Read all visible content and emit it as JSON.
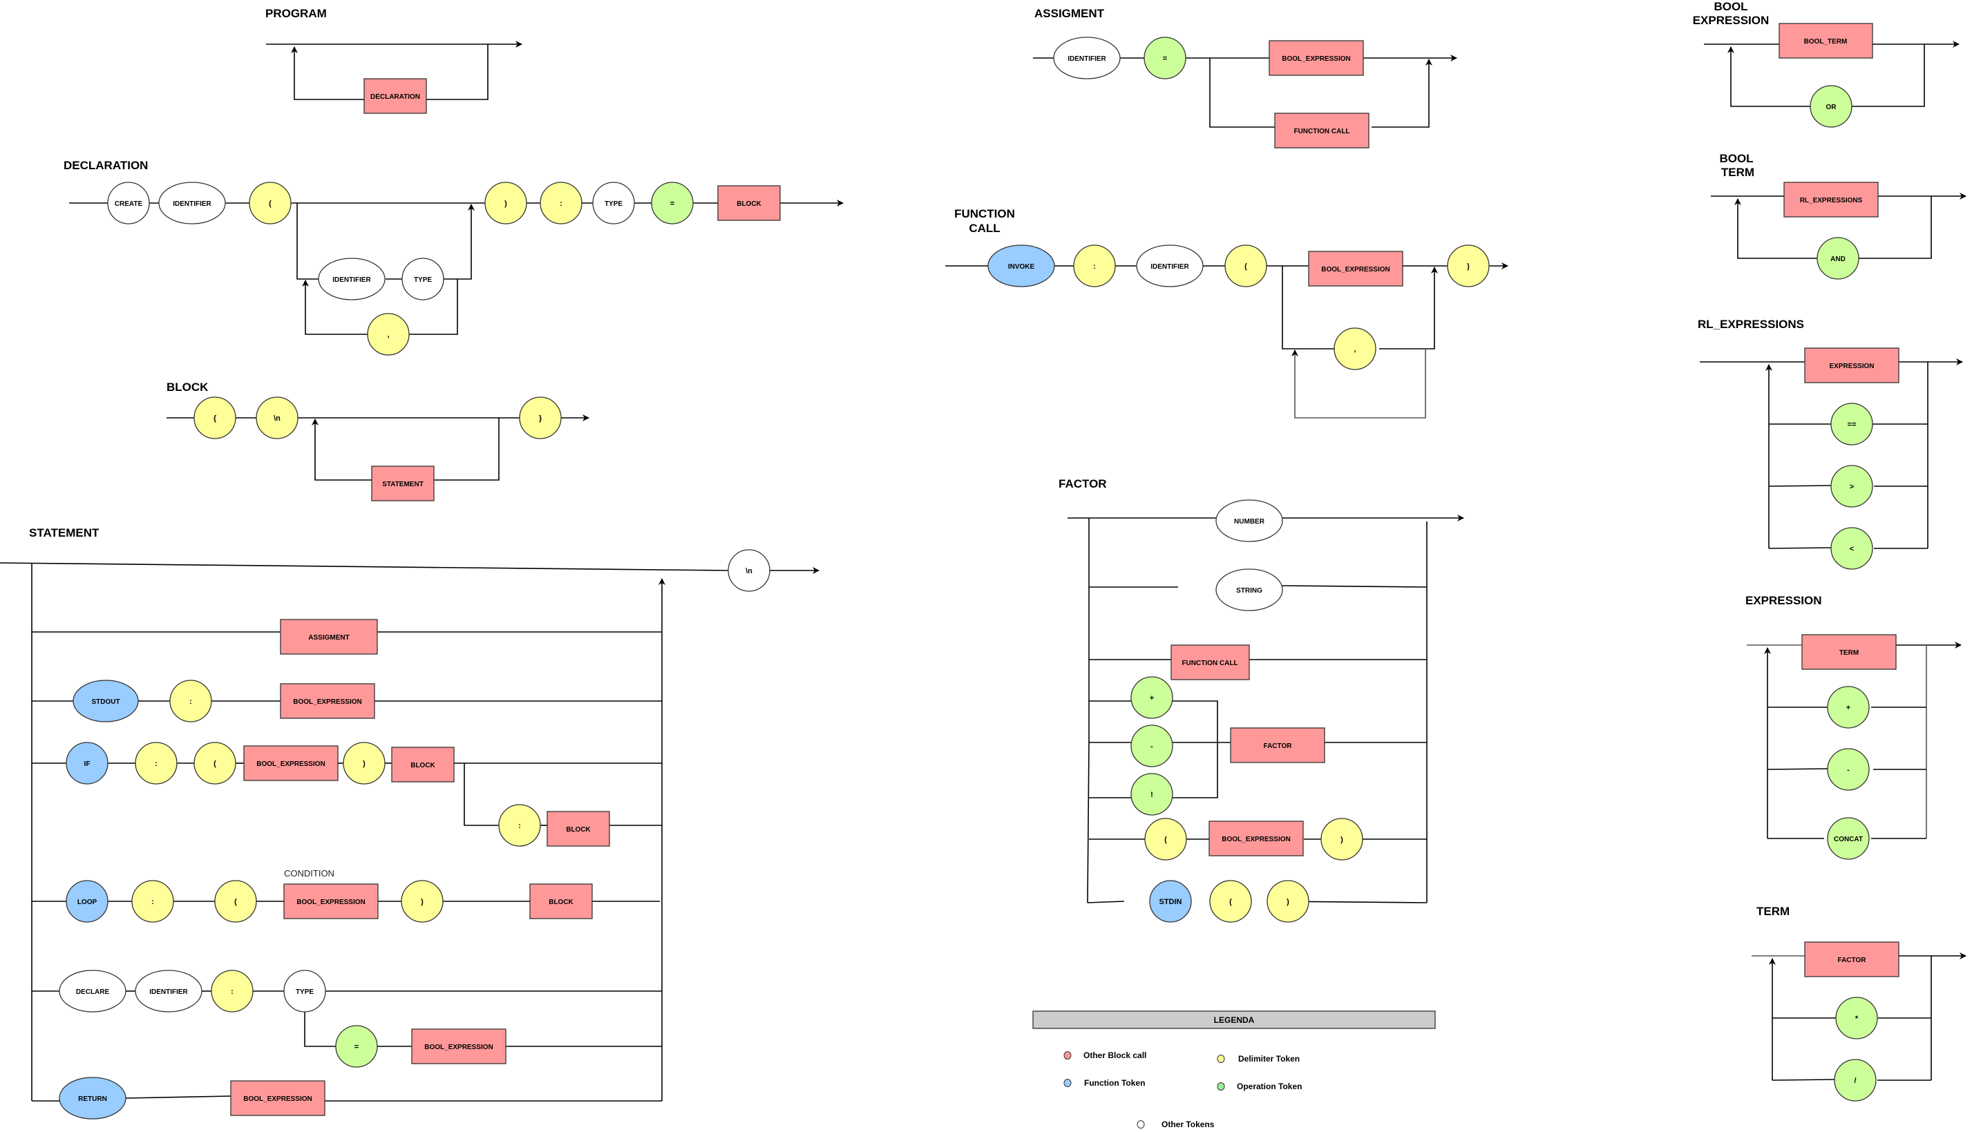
{
  "colors": {
    "block_call": "#ff9999",
    "function_token": "#99ccff",
    "delimiter_token": "#ffff99",
    "operation_token": "#ccff99",
    "other_token": "#ffffff",
    "legend_header": "#cccccc"
  },
  "titles": {
    "program": "PROGRAM",
    "declaration": "DECLARATION",
    "block": "BLOCK",
    "statement": "STATEMENT",
    "assigment": "ASSIGMENT",
    "function_call_1": "FUNCTION",
    "function_call_2": "CALL",
    "factor": "FACTOR",
    "bool_expression_1": "BOOL",
    "bool_expression_2": "EXPRESSION",
    "bool_term_1": "BOOL",
    "bool_term_2": "TERM",
    "rl_expressions": "RL_EXPRESSIONS",
    "expression": "EXPRESSION",
    "term": "TERM"
  },
  "program": {
    "declaration": "DECLARATION"
  },
  "declaration": {
    "create": "CREATE",
    "identifier": "IDENTIFIER",
    "lparen": "(",
    "rparen": ")",
    "colon": ":",
    "type": "TYPE",
    "assign": "=",
    "block": "BLOCK",
    "param_identifier": "IDENTIFIER",
    "param_type": "TYPE",
    "comma": ","
  },
  "block": {
    "lbrace": "{",
    "newline": "\\n",
    "statement": "STATEMENT",
    "rbrace": "}"
  },
  "statement": {
    "newline": "\\n",
    "assigment": "ASSIGMENT",
    "stdout": "STDOUT",
    "stdout_colon": ":",
    "stdout_expr": "BOOL_EXPRESSION",
    "if": "IF",
    "if_colon": ":",
    "if_lparen": "(",
    "if_expr": "BOOL_EXPRESSION",
    "if_rparen": ")",
    "if_block": "BLOCK",
    "else_colon": ":",
    "else_block": "BLOCK",
    "condition_note": "CONDITION",
    "loop": "LOOP",
    "loop_colon": ":",
    "loop_lparen": "(",
    "loop_expr": "BOOL_EXPRESSION",
    "loop_rparen": ")",
    "loop_block": "BLOCK",
    "declare": "DECLARE",
    "declare_identifier": "IDENTIFIER",
    "declare_colon": ":",
    "declare_type": "TYPE",
    "declare_assign": "=",
    "declare_expr": "BOOL_EXPRESSION",
    "return": "RETURN",
    "return_expr": "BOOL_EXPRESSION"
  },
  "assigment": {
    "identifier": "IDENTIFIER",
    "assign": "=",
    "bool_expression": "BOOL_EXPRESSION",
    "function_call": "FUNCTION CALL"
  },
  "function_call": {
    "invoke": "INVOKE",
    "colon": ":",
    "identifier": "IDENTIFIER",
    "lparen": "(",
    "bool_expression": "BOOL_EXPRESSION",
    "comma": ",",
    "rparen": ")"
  },
  "factor": {
    "number": "NUMBER",
    "string": "STRING",
    "function_call": "FUNCTION CALL",
    "plus": "+",
    "minus": "-",
    "not": "!",
    "factor": "FACTOR",
    "lparen": "(",
    "bool_expression": "BOOL_EXPRESSION",
    "rparen": ")",
    "stdin": "STDIN",
    "stdin_lparen": "(",
    "stdin_rparen": ")"
  },
  "bool_expression": {
    "bool_term": "BOOL_TERM",
    "or": "OR"
  },
  "bool_term": {
    "rl_expressions": "RL_EXPRESSIONS",
    "and": "AND"
  },
  "rl_expressions": {
    "expression": "EXPRESSION",
    "eq": "==",
    "gt": ">",
    "lt": "<"
  },
  "expression": {
    "term": "TERM",
    "plus": "+",
    "minus": "-",
    "concat": "CONCAT"
  },
  "term": {
    "factor": "FACTOR",
    "mul": "*",
    "div": "/"
  },
  "legend": {
    "header": "LEGENDA",
    "items": [
      {
        "label": "Other Block call",
        "kind": "block_call"
      },
      {
        "label": "Function Token",
        "kind": "function_token"
      },
      {
        "label": "Delimiter Token",
        "kind": "delimiter_token"
      },
      {
        "label": "Operation Token",
        "kind": "operation_token"
      },
      {
        "label": "Other Tokens",
        "kind": "other_token"
      }
    ]
  }
}
